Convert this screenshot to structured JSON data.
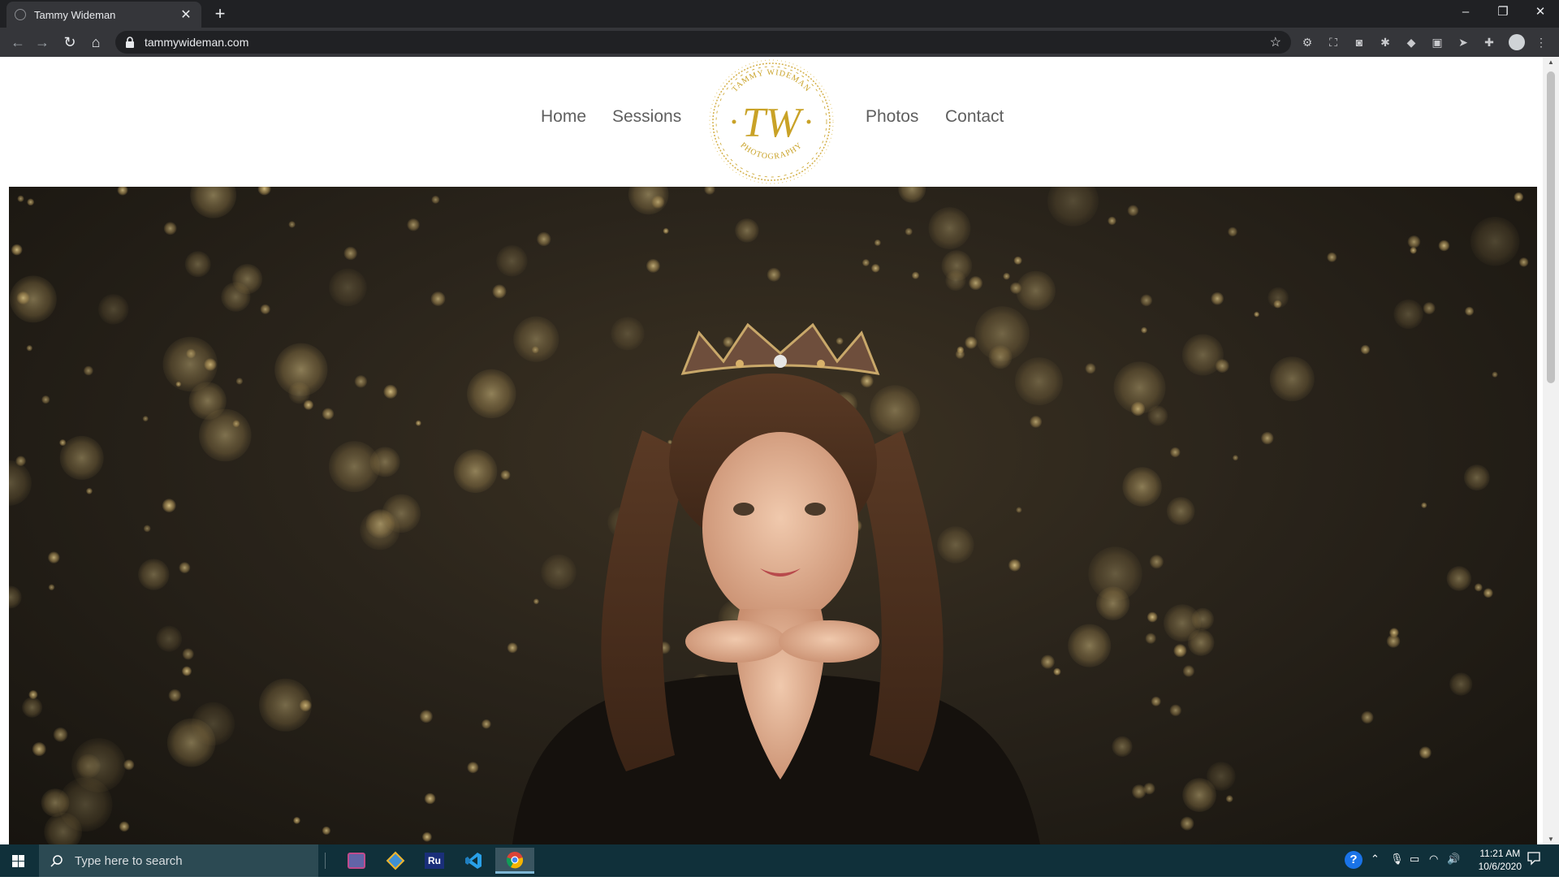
{
  "browser": {
    "tab_title": "Tammy Wideman",
    "new_tab": "+",
    "url": "tammywideman.com",
    "window_controls": [
      "–",
      "❐",
      "✕"
    ]
  },
  "site": {
    "nav": [
      "Home",
      "Sessions",
      "Photos",
      "Contact"
    ],
    "logo": {
      "monogram": "TW",
      "top_text": "TAMMY WIDEMAN",
      "bottom_text": "PHOTOGRAPHY",
      "color": "#c9a227"
    }
  },
  "taskbar": {
    "search_placeholder": "Type here to search",
    "time": "11:21 AM",
    "date": "10/6/2020",
    "apps": [
      "teams-icon",
      "git-icon",
      "rufus-icon",
      "vscode-icon",
      "chrome-icon"
    ],
    "app_label_ru": "Ru"
  },
  "colors": {
    "chrome_dark": "#202124",
    "chrome_mid": "#35363a",
    "taskbar": "#10303a",
    "gold": "#c9a227"
  }
}
